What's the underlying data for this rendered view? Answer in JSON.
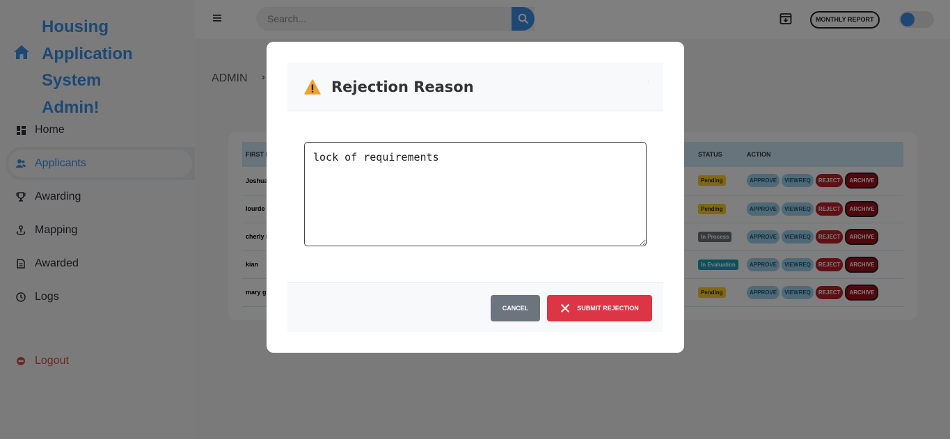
{
  "brand": {
    "line1": "Housing Application",
    "line2": "System",
    "line3": "Admin!"
  },
  "sidebar": {
    "items": [
      {
        "label": "Home",
        "icon": "dashboard-icon"
      },
      {
        "label": "Applicants",
        "icon": "users-icon",
        "active": true
      },
      {
        "label": "Awarding",
        "icon": "trophy-icon"
      },
      {
        "label": "Mapping",
        "icon": "location-icon"
      },
      {
        "label": "Awarded",
        "icon": "document-icon"
      },
      {
        "label": "Logs",
        "icon": "clock-icon"
      }
    ],
    "logout": "Logout"
  },
  "topbar": {
    "search_placeholder": "Search...",
    "monthly_report": "MONTHLY REPORT"
  },
  "breadcrumb": {
    "root": "ADMIN",
    "sep": "›"
  },
  "table": {
    "headers": [
      "FIRST NAME",
      "STATUS",
      "ACTION"
    ],
    "rows": [
      {
        "name": "Joshua",
        "status": "Pending"
      },
      {
        "name": "lourde",
        "status": "Pending"
      },
      {
        "name": "cherly mae",
        "status": "In Process"
      },
      {
        "name": "kian",
        "status": "In Evaluation"
      },
      {
        "name": "mary grace",
        "status": "Pending"
      }
    ],
    "actions": {
      "approve": "APPROVE",
      "viewreq": "VIEWREQ",
      "reject": "REJECT",
      "archive": "ARCHIVE"
    }
  },
  "modal": {
    "title": "Rejection Reason",
    "reason_value": "lock of requirements",
    "cancel": "CANCEL",
    "submit": "SUBMIT REJECTION",
    "close_glyph": "·"
  },
  "colors": {
    "accent": "#3c91e6",
    "danger": "#dc3545",
    "secondary": "#6c757d",
    "warning": "#f0a030"
  }
}
